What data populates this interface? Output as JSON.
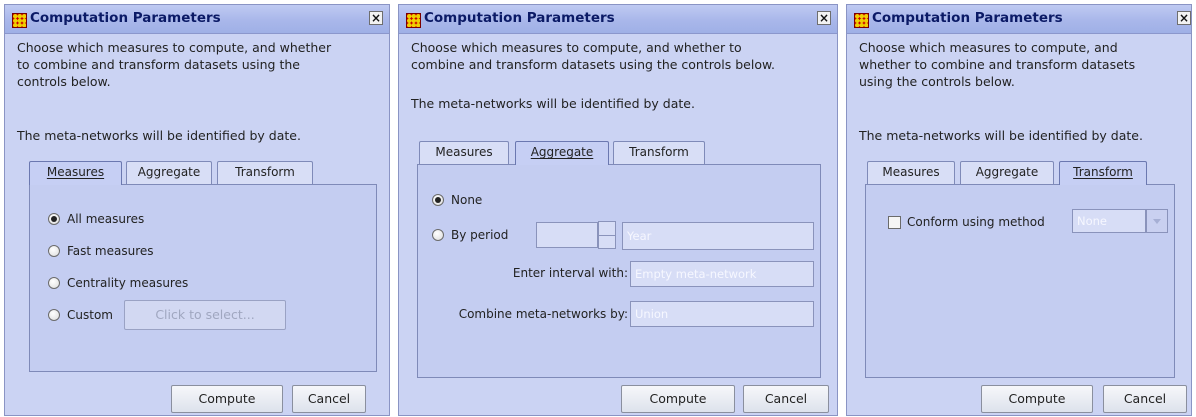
{
  "dialogs": [
    {
      "title": "Computation Parameters",
      "close": "×",
      "desc_lines": [
        "Choose which measures to compute, and whether",
        "to combine and transform datasets using the",
        "controls below."
      ],
      "note": "The meta-networks will be identified by date.",
      "tabs": [
        "Measures",
        "Aggregate",
        "Transform"
      ],
      "active_tab": "Measures",
      "options": [
        "All measures",
        "Fast measures",
        "Centrality measures",
        "Custom"
      ],
      "selected_option": "All measures",
      "custom_button": "Click to select...",
      "compute": "Compute",
      "cancel": "Cancel"
    },
    {
      "title": "Computation Parameters",
      "close": "×",
      "desc_lines": [
        "Choose which measures to compute, and whether to",
        "combine and transform datasets using the controls below."
      ],
      "note": "The meta-networks will be identified by date.",
      "tabs": [
        "Measures",
        "Aggregate",
        "Transform"
      ],
      "active_tab": "Aggregate",
      "none_label": "None",
      "period_label": "By period",
      "period_unit": "Year",
      "interval_label": "Enter interval with:",
      "interval_value": "Empty meta-network",
      "combine_label": "Combine meta-networks by:",
      "combine_value": "Union",
      "selected_option": "None",
      "compute": "Compute",
      "cancel": "Cancel"
    },
    {
      "title": "Computation Parameters",
      "close": "×",
      "desc_lines": [
        "Choose which measures to compute, and",
        "whether to combine and transform datasets",
        "using the controls below."
      ],
      "note": "The meta-networks will be identified by date.",
      "tabs": [
        "Measures",
        "Aggregate",
        "Transform"
      ],
      "active_tab": "Transform",
      "conform_label": "Conform using method",
      "conform_value": "None",
      "compute": "Compute",
      "cancel": "Cancel"
    }
  ]
}
